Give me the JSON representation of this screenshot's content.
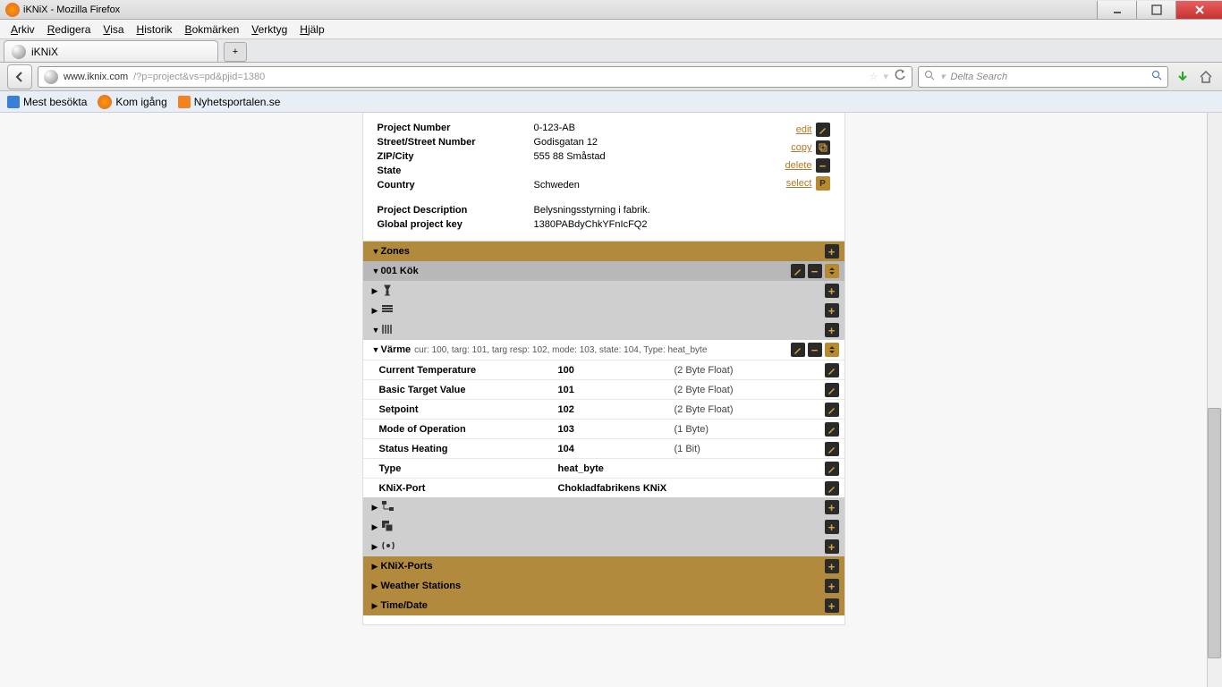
{
  "window": {
    "title": "iKNiX - Mozilla Firefox"
  },
  "menu": {
    "arkiv": "Arkiv",
    "redigera": "Redigera",
    "visa": "Visa",
    "historik": "Historik",
    "bokmarken": "Bokmärken",
    "verktyg": "Verktyg",
    "hjalp": "Hjälp"
  },
  "tab": {
    "title": "iKNiX"
  },
  "url": {
    "host": "www.iknix.com",
    "path": "/?p=project&vs=pd&pjid=1380"
  },
  "search": {
    "placeholder": "Delta Search"
  },
  "bookmarks": {
    "mest": "Mest besökta",
    "kom": "Kom igång",
    "nyh": "Nyhetsportalen.se"
  },
  "project": {
    "number_lbl": "Project Number",
    "number": "0-123-AB",
    "street_lbl": "Street/Street Number",
    "street": "Godisgatan 12",
    "zip_lbl": "ZIP/City",
    "zip": "555 88 Småstad",
    "state_lbl": "State",
    "state": "",
    "country_lbl": "Country",
    "country": "Schweden",
    "desc_lbl": "Project Description",
    "desc": "Belysningsstyrning i fabrik.",
    "key_lbl": "Global project key",
    "key": "1380PABdyChkYFnIcFQ2"
  },
  "actions": {
    "edit": "edit",
    "copy": "copy",
    "delete": "delete",
    "select": "select"
  },
  "zones_lbl": "Zones",
  "zone1_lbl": "001 Kök",
  "varme": {
    "label": "Värme",
    "meta": "cur: 100, targ: 101, targ resp: 102, mode: 103, state: 104, Type: heat_byte"
  },
  "params": [
    {
      "lbl": "Current Temperature",
      "val": "100",
      "type": "(2 Byte Float)"
    },
    {
      "lbl": "Basic Target Value",
      "val": "101",
      "type": "(2 Byte Float)"
    },
    {
      "lbl": "Setpoint",
      "val": "102",
      "type": "(2 Byte Float)"
    },
    {
      "lbl": "Mode of Operation",
      "val": "103",
      "type": "(1 Byte)"
    },
    {
      "lbl": "Status Heating",
      "val": "104",
      "type": "(1 Bit)"
    },
    {
      "lbl": "Type",
      "val": "heat_byte",
      "type": ""
    },
    {
      "lbl": "KNiX-Port",
      "val": "Chokladfabrikens KNiX",
      "type": ""
    }
  ],
  "sections": {
    "knixports": "KNiX-Ports",
    "weather": "Weather Stations",
    "timedate": "Time/Date"
  }
}
